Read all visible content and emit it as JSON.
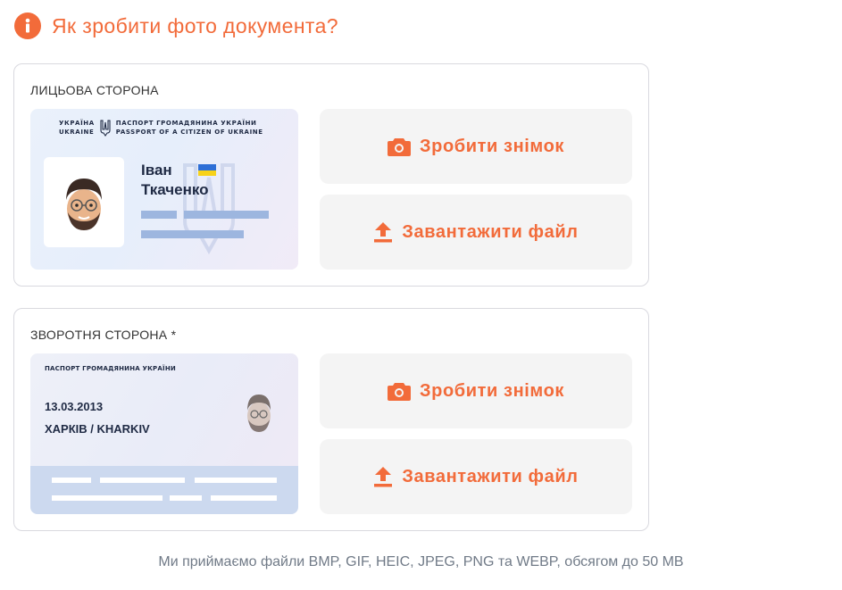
{
  "header": {
    "icon": "info-icon",
    "title": "Як зробити фото документа?"
  },
  "front": {
    "label": "ЛИЦЬОВА СТОРОНА",
    "doc": {
      "country_ua": "УКРАЇНА",
      "country_en": "UKRAINE",
      "title_ua": "ПАСПОРТ ГРОМАДЯНИНА УКРАЇНИ",
      "title_en": "PASSPORT OF A CITIZEN OF UKRAINE",
      "first_name": "Іван",
      "last_name": "Ткаченко"
    },
    "take_photo_label": "Зробити знімок",
    "upload_label": "Завантажити файл"
  },
  "back": {
    "label": "ЗВОРОТНЯ СТОРОНА *",
    "doc": {
      "header": "ПАСПОРТ ГРОМАДЯНИНА УКРАЇНИ",
      "date": "13.03.2013",
      "city": "ХАРКІВ / KHARKIV"
    },
    "take_photo_label": "Зробити знімок",
    "upload_label": "Завантажити файл"
  },
  "footer": {
    "note": "Ми приймаємо файли BMP, GIF, HEIC, JPEG, PNG та WEBP, обсягом до 50 MB"
  },
  "colors": {
    "accent": "#f26b3a",
    "button_bg": "#f4f4f4",
    "card_border": "#d9d9df",
    "doc_bar": "#9db6df"
  }
}
